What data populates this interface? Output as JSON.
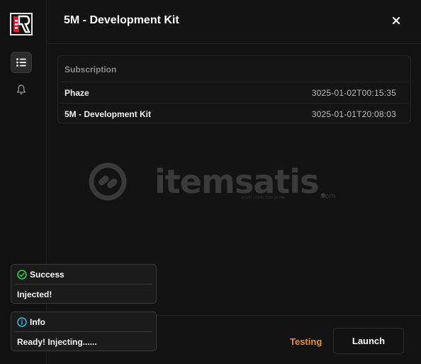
{
  "header": {
    "title": "5M - Development Kit"
  },
  "sidebar": {
    "items": [
      {
        "icon": "list-icon",
        "active": true
      },
      {
        "icon": "bell-icon",
        "active": false
      }
    ]
  },
  "subscription_table": {
    "header": "Subscription",
    "rows": [
      {
        "name": "Phaze",
        "date": "3025-01-02T00:15:35"
      },
      {
        "name": "5M - Development Kit",
        "date": "3025-01-01T20:08:03"
      }
    ]
  },
  "watermark": {
    "brand": "itemsatis",
    "tagline": "HESAP | SKIN | ITEM | E-PIN",
    "domain": ".com"
  },
  "footer": {
    "testing_label": "Testing",
    "launch_label": "Launch"
  },
  "toasts": [
    {
      "type": "success",
      "title": "Success",
      "message": "Injected!",
      "color": "#2ecc40"
    },
    {
      "type": "info",
      "title": "Info",
      "message": "Ready! Injecting......",
      "color": "#2bb5d8"
    }
  ],
  "colors": {
    "accent_orange": "#e89323",
    "background": "#131313"
  }
}
